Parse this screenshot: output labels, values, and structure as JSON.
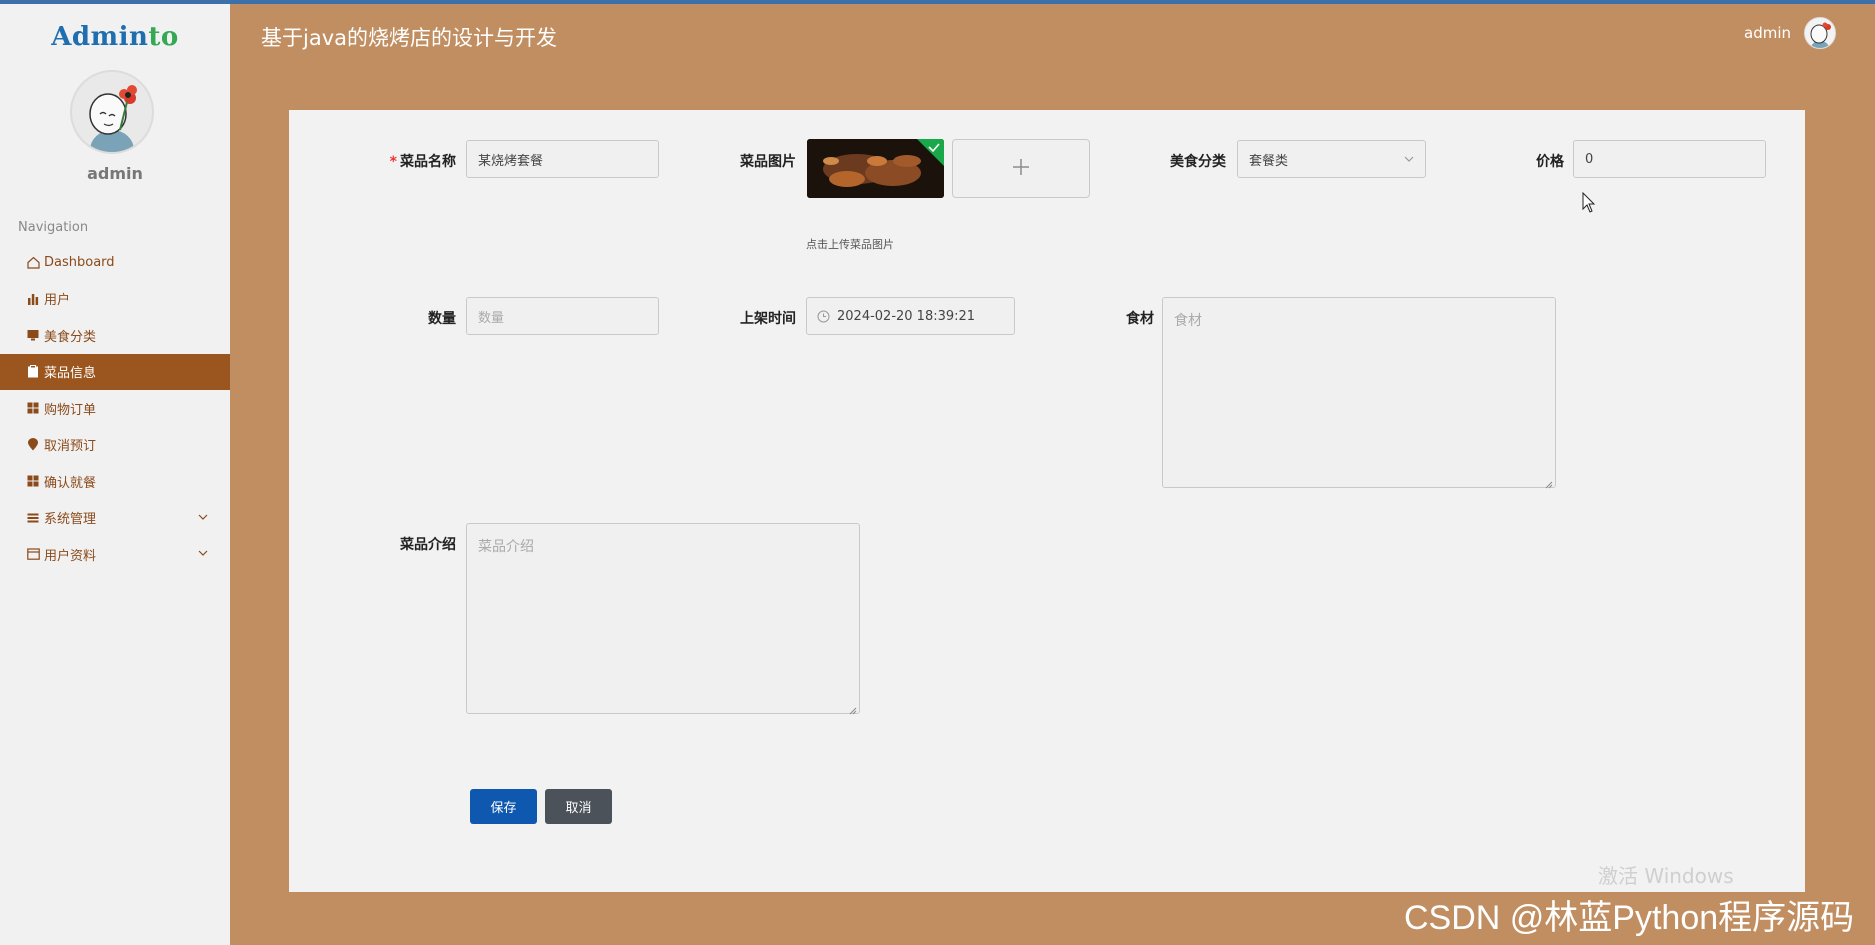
{
  "app": {
    "logo_main": "Admin",
    "logo_accent": "to",
    "title": "基于java的烧烤店的设计与开发",
    "current_user": "admin"
  },
  "sidebar": {
    "username": "admin",
    "nav_title": "Navigation",
    "items": [
      {
        "label": "Dashboard",
        "icon": "home-icon"
      },
      {
        "label": "用户",
        "icon": "bar-chart-icon"
      },
      {
        "label": "美食分类",
        "icon": "monitor-icon"
      },
      {
        "label": "菜品信息",
        "icon": "clipboard-icon",
        "active": true
      },
      {
        "label": "购物订单",
        "icon": "grid-icon"
      },
      {
        "label": "取消预订",
        "icon": "pin-icon"
      },
      {
        "label": "确认就餐",
        "icon": "grid-icon"
      },
      {
        "label": "系统管理",
        "icon": "list-icon",
        "expandable": true
      },
      {
        "label": "用户资料",
        "icon": "calendar-icon",
        "expandable": true
      }
    ]
  },
  "form": {
    "name_label": "菜品名称",
    "name_value": "某烧烤套餐",
    "image_label": "菜品图片",
    "image_hint": "点击上传菜品图片",
    "upload_icon": "plus-icon",
    "category_label": "美食分类",
    "category_value": "套餐类",
    "price_label": "价格",
    "price_value": "0",
    "quantity_label": "数量",
    "quantity_placeholder": "数量",
    "time_label": "上架时间",
    "time_value": "2024-02-20 18:39:21",
    "ingredients_label": "食材",
    "ingredients_placeholder": "食材",
    "intro_label": "菜品介绍",
    "intro_placeholder": "菜品介绍",
    "save_label": "保存",
    "cancel_label": "取消"
  },
  "watermarks": {
    "windows": "激活 Windows",
    "csdn": "CSDN @林蓝Python程序源码"
  },
  "colors": {
    "background": "#c18e61",
    "active_nav": "#9b561f",
    "save_button": "#0f58b0",
    "cancel_button": "#4b525a"
  }
}
